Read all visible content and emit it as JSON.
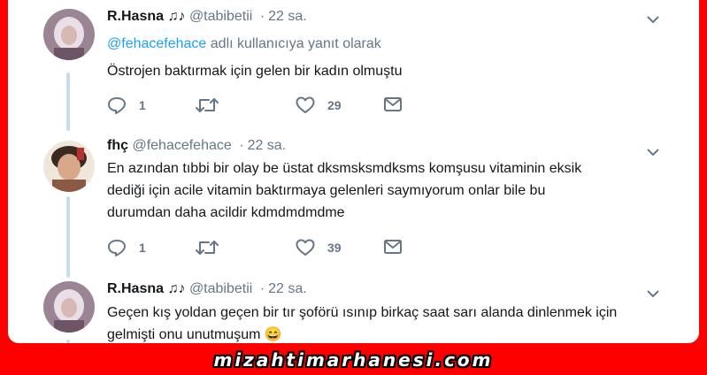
{
  "tweets": [
    {
      "name": "R.Hasna",
      "name_suffix": "♫♪",
      "handle": "@tabibetii",
      "sep": "·",
      "time": "22 sa.",
      "reply_mention": "@fehacefehace",
      "reply_rest": " adlı kullanıcıya yanıt olarak",
      "text": "Östrojen baktırmak için gelen bir kadın olmuştu",
      "replies": "1",
      "retweets": "",
      "likes": "29"
    },
    {
      "name": "fhç",
      "handle": "@fehacefehace",
      "sep": "·",
      "time": "22 sa.",
      "text_lines": [
        "En azından tıbbi bir olay be üstat dksmsksmdksms komşusu vitaminin eksik",
        "dediği için acile vitamin baktırmaya gelenleri saymıyorum onlar bile bu",
        "durumdan daha acildir kdmdmdmdme"
      ],
      "replies": "1",
      "retweets": "",
      "likes": "39"
    },
    {
      "name": "R.Hasna",
      "name_suffix": "♫♪",
      "handle": "@tabibetii",
      "sep": "·",
      "time": "22 sa.",
      "text_lines": [
        "Geçen kış yoldan geçen bir tır şoförü ısınıp birkaç saat sarı alanda dinlenmek için",
        "gelmişti onu unutmuşum 😄"
      ]
    }
  ],
  "footer": {
    "watermark": "mizahtimarhanesi.com"
  },
  "colors": {
    "background_frame": "#ff0000",
    "link": "#1da1f2",
    "muted": "#657786",
    "thread_line": "#c4def0"
  },
  "icons": [
    "reply-icon",
    "retweet-icon",
    "heart-icon",
    "message-icon",
    "chevron-down-icon"
  ]
}
